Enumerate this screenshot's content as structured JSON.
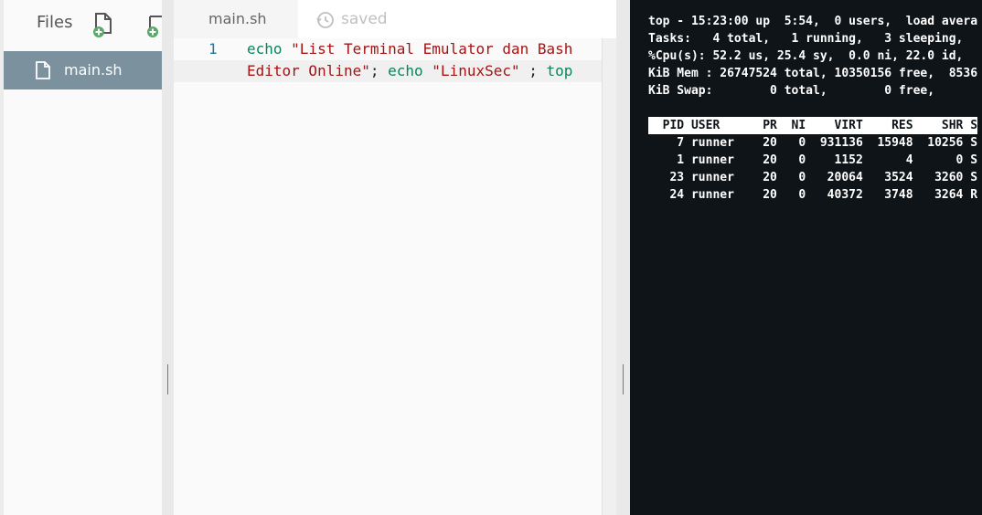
{
  "files": {
    "title": "Files",
    "icons": [
      "new-file-icon",
      "new-folder-icon"
    ],
    "items": [
      {
        "label": "main.sh",
        "icon": "file-icon"
      }
    ]
  },
  "editor": {
    "tab_label": "main.sh",
    "status_label": "saved",
    "status_icon": "history-icon",
    "line_number": "1",
    "code": {
      "line1_kw": "echo",
      "line1_str": "\"List Terminal Emulator dan Bash",
      "line2_str": "Editor Online\"",
      "line2_sep1": "; ",
      "line2_kw1": "echo",
      "line2_str2": "\"LinuxSec\"",
      "line2_sep2": " ; ",
      "line2_kw2": "top"
    }
  },
  "terminal": {
    "lines": [
      "top - 15:23:00 up  5:54,  0 users,  load avera",
      "Tasks:   4 total,   1 running,   3 sleeping,",
      "%Cpu(s): 52.2 us, 25.4 sy,  0.0 ni, 22.0 id,",
      "KiB Mem : 26747524 total, 10350156 free,  8536",
      "KiB Swap:        0 total,        0 free,",
      ""
    ],
    "header": "  PID USER      PR  NI    VIRT    RES    SHR S",
    "processes": [
      "    7 runner    20   0  931136  15948  10256 S",
      "    1 runner    20   0    1152      4      0 S",
      "   23 runner    20   0   20064   3524   3260 S",
      "   24 runner    20   0   40372   3748   3264 R"
    ]
  },
  "colors": {
    "selected_item": "#7b929e",
    "terminal_bg": "#0f1419",
    "keyword": "#098658",
    "string": "#a31515",
    "line_number": "#237893"
  }
}
